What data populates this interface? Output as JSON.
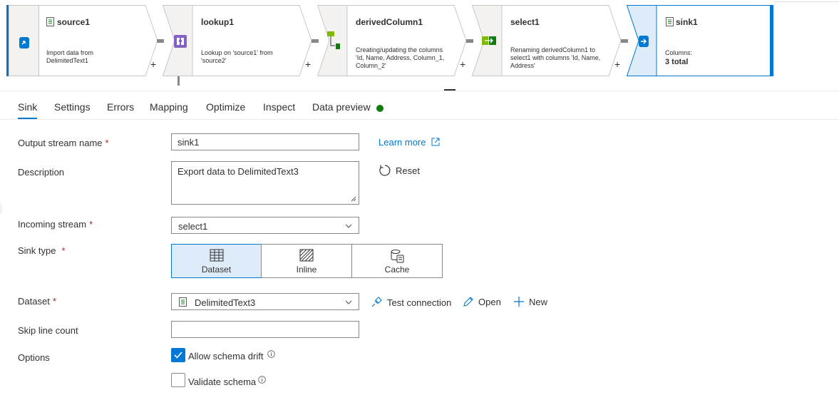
{
  "pipeline": {
    "nodes": [
      {
        "id": "source1",
        "title": "source1",
        "desc": [
          "Import data from",
          "DelimitedText1"
        ]
      },
      {
        "id": "lookup1",
        "title": "lookup1",
        "desc": [
          "Lookup on 'source1' from",
          "'source2'"
        ]
      },
      {
        "id": "derivedColumn1",
        "title": "derivedColumn1",
        "desc": [
          "Creating/updating the columns",
          "'Id, Name, Address, Column_1,",
          "Column_2'"
        ]
      },
      {
        "id": "select1",
        "title": "select1",
        "desc": [
          "Renaming derivedColumn1 to",
          "select1 with columns 'Id, Name,",
          "Address'"
        ]
      },
      {
        "id": "sink1",
        "title": "sink1",
        "desc": [
          "Columns:"
        ],
        "desc_bold": "3 total"
      }
    ],
    "plus": "+"
  },
  "tabs": [
    "Sink",
    "Settings",
    "Errors",
    "Mapping",
    "Optimize",
    "Inspect",
    "Data preview"
  ],
  "form": {
    "output_stream_label": "Output stream name",
    "output_stream_value": "sink1",
    "required_mark": "*",
    "learn_more": "Learn more",
    "description_label": "Description",
    "description_value": "Export data to DelimitedText3",
    "reset": "Reset",
    "incoming_label": "Incoming stream",
    "incoming_value": "select1",
    "sink_type_label": "Sink type",
    "sink_types": [
      "Dataset",
      "Inline",
      "Cache"
    ],
    "sink_type_selected": "Dataset",
    "dataset_label": "Dataset",
    "dataset_value": "DelimitedText3",
    "test_connection": "Test connection",
    "open": "Open",
    "new": "New",
    "skip_label": "Skip line count",
    "skip_value": "",
    "options_label": "Options",
    "allow_schema_drift": "Allow schema drift",
    "allow_schema_drift_checked": true,
    "validate_schema": "Validate schema",
    "validate_schema_checked": false
  },
  "colors": {
    "accent": "#0078d4",
    "status_ok": "#107c10",
    "selected_bg": "#deecf9"
  }
}
